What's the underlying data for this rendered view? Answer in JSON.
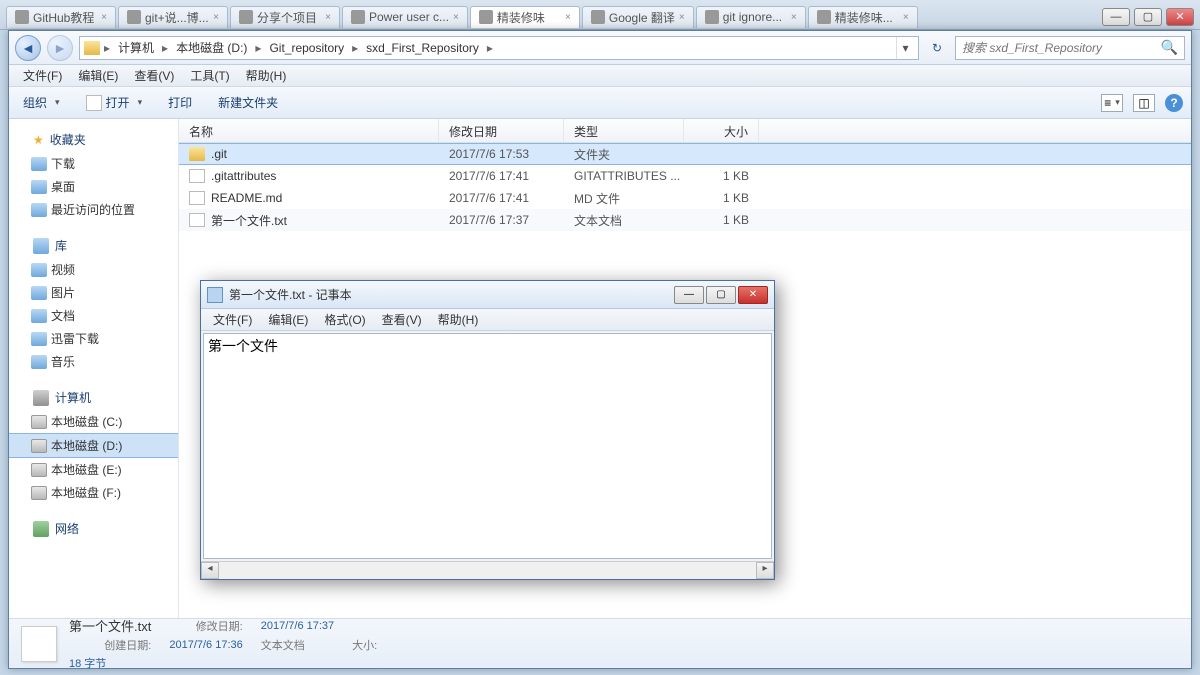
{
  "browser_tabs": [
    "GitHub教程",
    "git+说...博...",
    "",
    "分享个项目",
    "Power user c...",
    "精装修味",
    "",
    "Google 翻译",
    "",
    "git ignore...",
    "精装修味...",
    ""
  ],
  "breadcrumbs": [
    "计算机",
    "本地磁盘 (D:)",
    "Git_repository",
    "sxd_First_Repository"
  ],
  "search_placeholder": "搜索 sxd_First_Repository",
  "menubar": [
    "文件(F)",
    "编辑(E)",
    "查看(V)",
    "工具(T)",
    "帮助(H)"
  ],
  "toolbar": {
    "organize": "组织",
    "open": "打开",
    "print": "打印",
    "new_folder": "新建文件夹"
  },
  "sidebar": {
    "favorites": {
      "label": "收藏夹",
      "items": [
        "下载",
        "桌面",
        "最近访问的位置"
      ]
    },
    "libraries": {
      "label": "库",
      "items": [
        "视频",
        "图片",
        "文档",
        "迅雷下载",
        "音乐"
      ]
    },
    "computer": {
      "label": "计算机",
      "items": [
        "本地磁盘 (C:)",
        "本地磁盘 (D:)",
        "本地磁盘 (E:)",
        "本地磁盘 (F:)"
      ],
      "selected": 1
    },
    "network": {
      "label": "网络"
    }
  },
  "columns": {
    "name": "名称",
    "date": "修改日期",
    "type": "类型",
    "size": "大小"
  },
  "files": [
    {
      "name": ".git",
      "date": "2017/7/6 17:53",
      "type": "文件夹",
      "size": "",
      "icon": "folder",
      "selected": true
    },
    {
      "name": ".gitattributes",
      "date": "2017/7/6 17:41",
      "type": "GITATTRIBUTES ...",
      "size": "1 KB",
      "icon": "file"
    },
    {
      "name": "README.md",
      "date": "2017/7/6 17:41",
      "type": "MD 文件",
      "size": "1 KB",
      "icon": "file"
    },
    {
      "name": "第一个文件.txt",
      "date": "2017/7/6 17:37",
      "type": "文本文档",
      "size": "1 KB",
      "icon": "file"
    }
  ],
  "details": {
    "name": "第一个文件.txt",
    "type": "文本文档",
    "mod_label": "修改日期:",
    "mod_val": "2017/7/6 17:37",
    "create_label": "创建日期:",
    "create_val": "2017/7/6 17:36",
    "size_label": "大小:",
    "size_val": "18 字节"
  },
  "notepad": {
    "title": "第一个文件.txt - 记事本",
    "menu": [
      "文件(F)",
      "编辑(E)",
      "格式(O)",
      "查看(V)",
      "帮助(H)"
    ],
    "content": "第一个文件"
  }
}
